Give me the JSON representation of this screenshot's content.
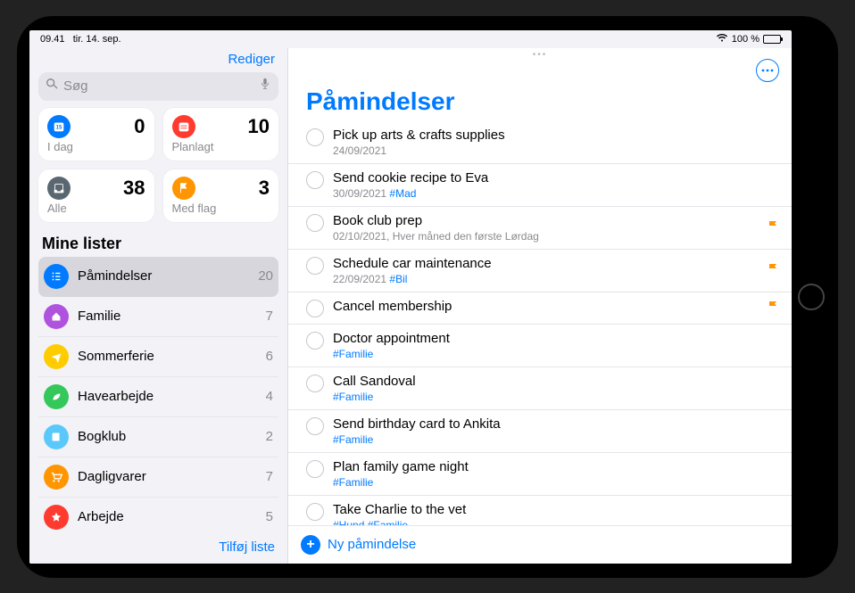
{
  "status": {
    "time": "09.41",
    "date": "tir. 14. sep.",
    "battery": "100 %"
  },
  "sidebar": {
    "edit": "Rediger",
    "search_placeholder": "Søg",
    "smart": [
      {
        "label": "I dag",
        "count": "0",
        "color": "#007aff",
        "icon": "calendar"
      },
      {
        "label": "Planlagt",
        "count": "10",
        "color": "#ff3b30",
        "icon": "calendar-lines"
      },
      {
        "label": "Alle",
        "count": "38",
        "color": "#5b6770",
        "icon": "tray"
      },
      {
        "label": "Med flag",
        "count": "3",
        "color": "#ff9500",
        "icon": "flag"
      }
    ],
    "lists_header": "Mine lister",
    "lists": [
      {
        "name": "Påmindelser",
        "count": "20",
        "color": "#007aff",
        "icon": "list",
        "selected": true
      },
      {
        "name": "Familie",
        "count": "7",
        "color": "#af52de",
        "icon": "house"
      },
      {
        "name": "Sommerferie",
        "count": "6",
        "color": "#ffcc00",
        "icon": "plane"
      },
      {
        "name": "Havearbejde",
        "count": "4",
        "color": "#34c759",
        "icon": "leaf"
      },
      {
        "name": "Bogklub",
        "count": "2",
        "color": "#5ac8fa",
        "icon": "book"
      },
      {
        "name": "Dagligvarer",
        "count": "7",
        "color": "#ff9500",
        "icon": "cart"
      },
      {
        "name": "Arbejde",
        "count": "5",
        "color": "#ff3b30",
        "icon": "star"
      }
    ],
    "add_list": "Tilføj liste"
  },
  "main": {
    "title": "Påmindelser",
    "new_reminder": "Ny påmindelse",
    "reminders": [
      {
        "title": "Pick up arts & crafts supplies",
        "sub": "24/09/2021",
        "tags": [],
        "flag": false
      },
      {
        "title": "Send cookie recipe to Eva",
        "sub": "30/09/2021",
        "tags": [
          "#Mad"
        ],
        "flag": false
      },
      {
        "title": "Book club prep",
        "sub": "02/10/2021, Hver måned den første Lørdag",
        "tags": [],
        "flag": true
      },
      {
        "title": "Schedule car maintenance",
        "sub": "22/09/2021",
        "tags": [
          "#Bil"
        ],
        "flag": true
      },
      {
        "title": "Cancel membership",
        "sub": "",
        "tags": [],
        "flag": true
      },
      {
        "title": "Doctor appointment",
        "sub": "",
        "tags": [
          "#Familie"
        ],
        "flag": false
      },
      {
        "title": "Call Sandoval",
        "sub": "",
        "tags": [
          "#Familie"
        ],
        "flag": false
      },
      {
        "title": "Send birthday card to Ankita",
        "sub": "",
        "tags": [
          "#Familie"
        ],
        "flag": false
      },
      {
        "title": "Plan family game night",
        "sub": "",
        "tags": [
          "#Familie"
        ],
        "flag": false
      },
      {
        "title": "Take Charlie to the vet",
        "sub": "",
        "tags": [
          "#Hund",
          "#Familie"
        ],
        "flag": false
      }
    ]
  }
}
